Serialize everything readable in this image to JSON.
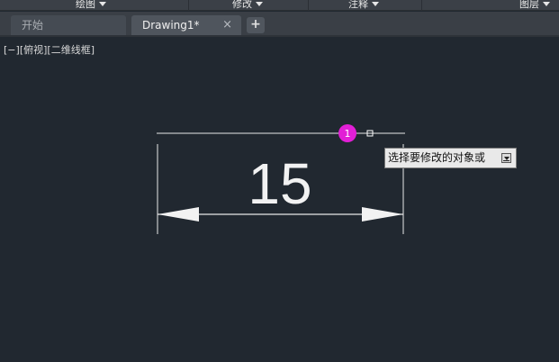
{
  "ribbon": {
    "panels": [
      {
        "label": "绘图"
      },
      {
        "label": "修改"
      },
      {
        "label": "注释"
      },
      {
        "label": "图层"
      }
    ]
  },
  "tabs": {
    "start_label": "开始",
    "drawing_label": "Drawing1*",
    "close_glyph": "×",
    "new_glyph": "+"
  },
  "viewport": {
    "minus": "[−]",
    "view": "[俯视]",
    "style": "[二维线框]"
  },
  "drawing": {
    "dimension_text": "15",
    "grip_number": "1",
    "grip_color": "#e21fd6",
    "line_color": "#e8e8e8"
  },
  "tooltip": {
    "prompt": "选择要修改的对象或"
  }
}
